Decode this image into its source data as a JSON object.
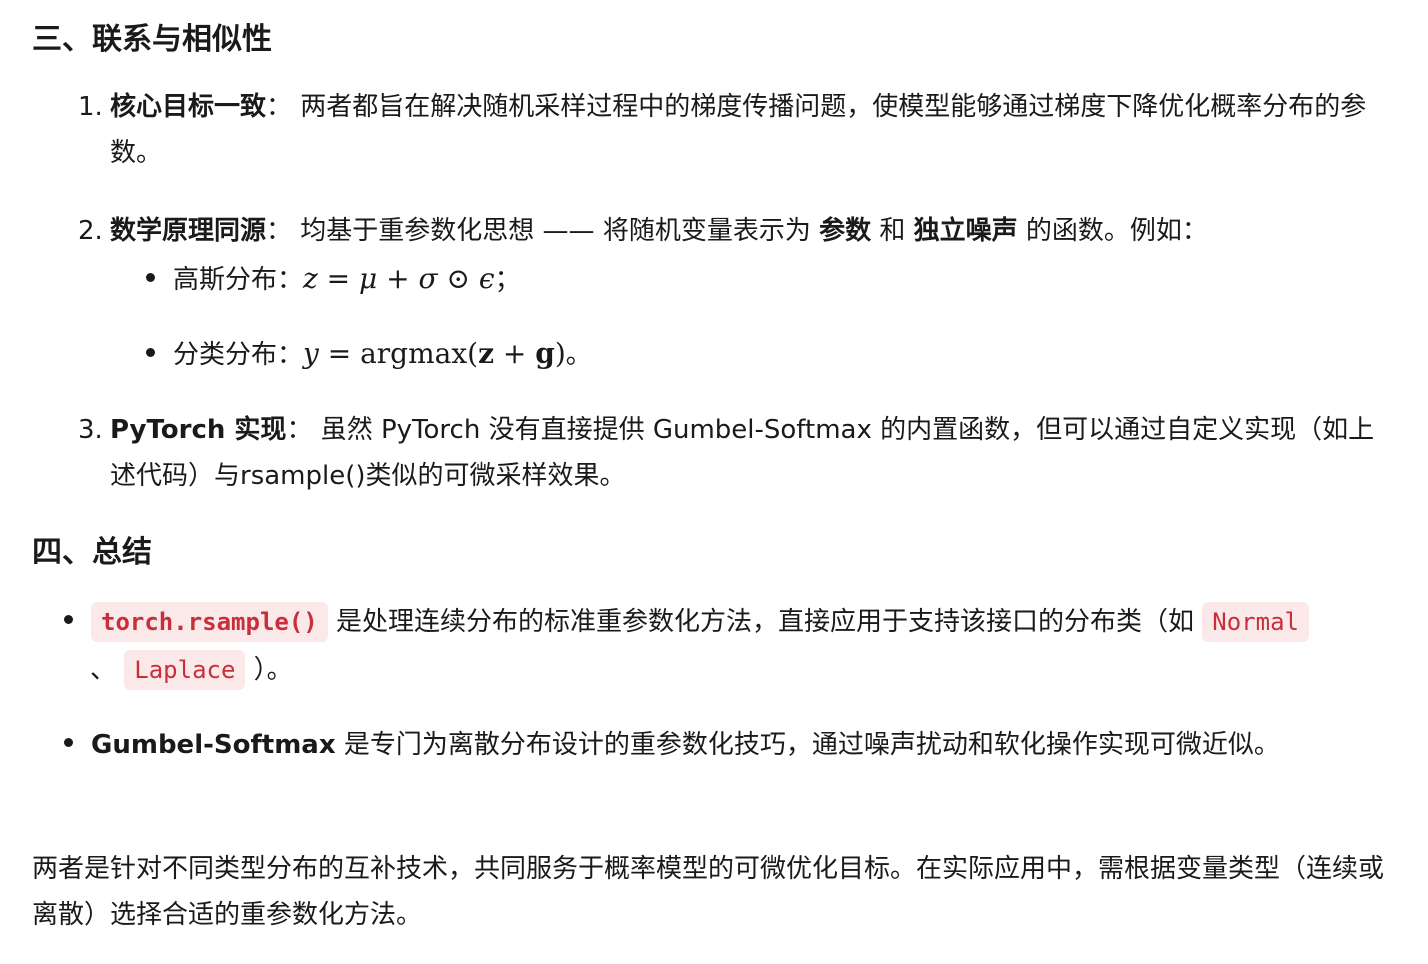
{
  "sections": {
    "s3": {
      "title": "三、联系与相似性",
      "items": [
        {
          "num": "1.",
          "bold": "核心目标一致",
          "sep": "：",
          "text": "两者都旨在解决随机采样过程中的梯度传播问题，使模型能够通过梯度下降优化概率分布的参数。"
        },
        {
          "num": "2.",
          "bold": "数学原理同源",
          "sep": "：",
          "text_a": "均基于重参数化思想 —— 将随机变量表示为 ",
          "bold_b": "参数",
          "text_c": " 和 ",
          "bold_d": "独立噪声",
          "text_e": " 的函数。例如：",
          "subitems": [
            {
              "label": "高斯分布：",
              "formula": "z = μ + σ ⊙ ϵ",
              "tail": "；"
            },
            {
              "label": "分类分布：",
              "formula": "y = argmax(z + g)",
              "tail": "。"
            }
          ]
        },
        {
          "num": "3.",
          "bold": "PyTorch 实现",
          "sep": "：",
          "text": "虽然 PyTorch 没有直接提供 Gumbel-Softmax 的内置函数，但可以通过自定义实现（如上述代码）与rsample()类似的可微采样效果。"
        }
      ]
    },
    "s4": {
      "title": "四、总结",
      "bullets": [
        {
          "code1": "torch.rsample()",
          "text1": " 是处理连续分布的标准重参数化方法，直接应用于支持该接口的分布类（如 ",
          "code2": "Normal",
          "text2": "、 ",
          "code3": "Laplace",
          "text3": " ）。"
        },
        {
          "bold": "Gumbel-Softmax",
          "text": " 是专门为离散分布设计的重参数化技巧，通过噪声扰动和软化操作实现可微近似。"
        }
      ]
    }
  },
  "conclusion": "两者是针对不同类型分布的互补技术，共同服务于概率模型的可微优化目标。在实际应用中，需根据变量类型（连续或离散）选择合适的重参数化方法。",
  "colors": {
    "text": "#1a1a1a",
    "code_text": "#c7303b",
    "code_bg": "#fbe9ea"
  }
}
